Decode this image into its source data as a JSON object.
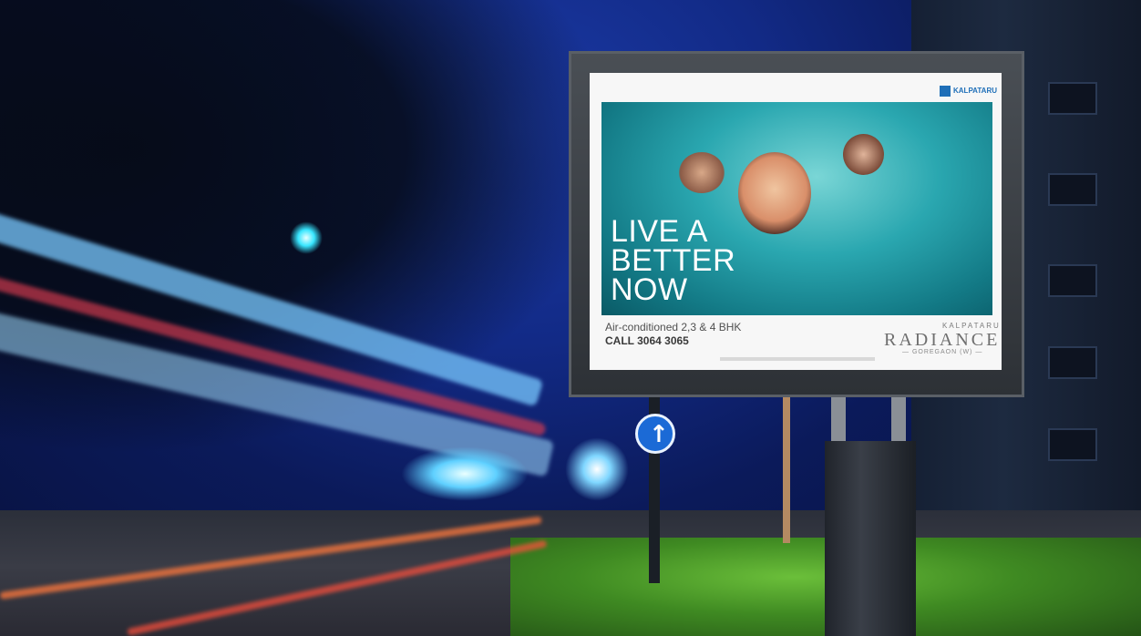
{
  "billboard": {
    "logo_text": "KALPATARU",
    "headline_lines": [
      "LIVE A",
      "BETTER",
      "NOW"
    ],
    "subtitle": "Air-conditioned 2,3 & 4 BHK",
    "phone": "CALL 3064 3065",
    "brand_top": "KALPATARU",
    "brand_name": "RADIANCE",
    "brand_location": "— GOREGAON (W) —"
  },
  "colors": {
    "sky": "#122a86",
    "pool": "#2aa7b0",
    "grass": "#3f8a22"
  }
}
